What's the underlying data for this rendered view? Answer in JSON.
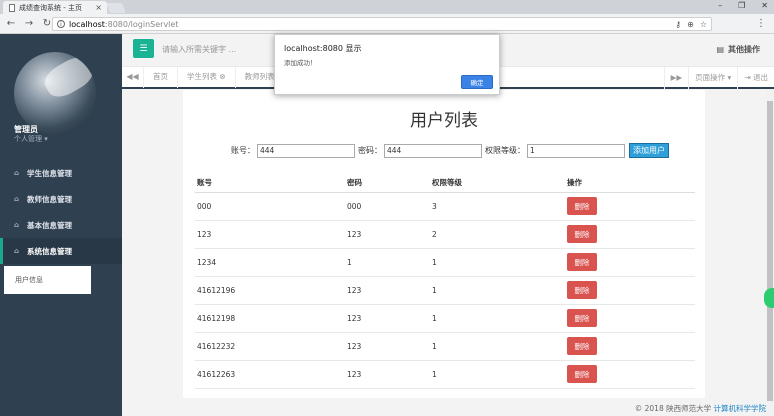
{
  "browser": {
    "tab_title": "成绩查询系统 - 主页",
    "url_host": "localhost",
    "url_path": ":8080/loginServlet",
    "info_icon": "i"
  },
  "sidebar": {
    "user_name": "管理员",
    "user_role": "个人管理 ▾",
    "items": [
      {
        "label": "学生信息管理",
        "icon": "home-icon"
      },
      {
        "label": "教师信息管理",
        "icon": "home-icon"
      },
      {
        "label": "基本信息管理",
        "icon": "home-icon"
      },
      {
        "label": "系统信息管理",
        "icon": "home-icon"
      }
    ],
    "sub_item": "用户信息"
  },
  "header": {
    "search_placeholder": "请输入所需关键字 ...",
    "more_ops": "其他操作"
  },
  "tabs": {
    "items": [
      "首页",
      "学生列表 ⊗",
      "教师列表 ⊗"
    ],
    "page_ops": "页面操作 ▾",
    "exit": "⇥ 退出"
  },
  "panel": {
    "title": "用户列表",
    "form": {
      "account_label": "账号：",
      "account_value": "444",
      "password_label": "密码：",
      "password_value": "444",
      "level_label": "权限等级：",
      "level_value": "1",
      "add_button": "添加用户"
    },
    "columns": [
      "账号",
      "密码",
      "权限等级",
      "操作"
    ],
    "delete_label": "删除",
    "rows": [
      {
        "account": "000",
        "password": "000",
        "level": "3"
      },
      {
        "account": "123",
        "password": "123",
        "level": "2"
      },
      {
        "account": "1234",
        "password": "1",
        "level": "1"
      },
      {
        "account": "41612196",
        "password": "123",
        "level": "1"
      },
      {
        "account": "41612198",
        "password": "123",
        "level": "1"
      },
      {
        "account": "41612232",
        "password": "123",
        "level": "1"
      },
      {
        "account": "41612263",
        "password": "123",
        "level": "1"
      }
    ]
  },
  "footer": {
    "text": "© 2018 陕西师范大学",
    "link": "计算机科学学院"
  },
  "dialog": {
    "title": "localhost:8080 显示",
    "message": "添加成功！",
    "ok": "确定"
  },
  "colors": {
    "sidebar": "#2f4050",
    "accent": "#1ab394",
    "danger": "#d9534f",
    "primary": "#2e9fd8"
  }
}
